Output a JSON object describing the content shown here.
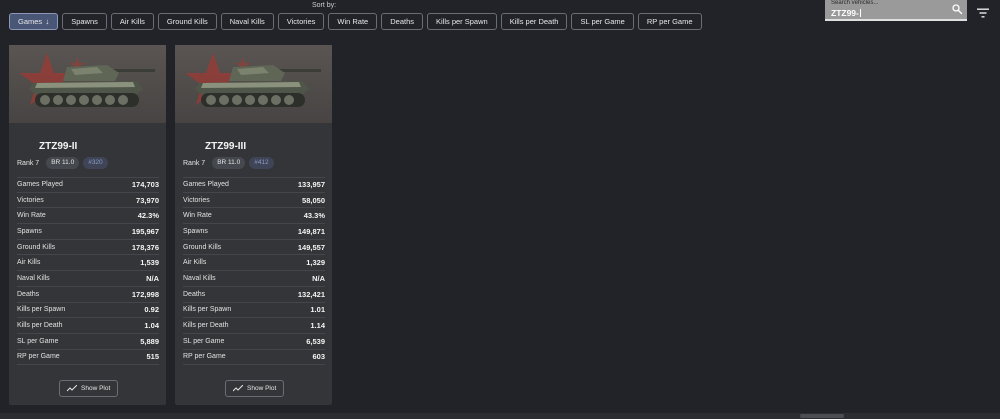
{
  "sort_label": "Sort by:",
  "sort_options": [
    {
      "label": "Games",
      "active": true,
      "icon": "arrow-down-icon"
    },
    {
      "label": "Spawns"
    },
    {
      "label": "Air Kills"
    },
    {
      "label": "Ground Kills"
    },
    {
      "label": "Naval Kills"
    },
    {
      "label": "Victories"
    },
    {
      "label": "Win Rate"
    },
    {
      "label": "Deaths"
    },
    {
      "label": "Kills per Spawn"
    },
    {
      "label": "Kills per Death"
    },
    {
      "label": "SL per Game"
    },
    {
      "label": "RP per Game"
    }
  ],
  "search": {
    "placeholder": "Search vehicles...",
    "value": "ZTZ99-"
  },
  "colors": {
    "background": "#212328",
    "card": "#343538",
    "active_sort": "#4a5676",
    "flag": "#a3312e"
  },
  "vehicles": [
    {
      "name": "ZTZ99-II",
      "rank": "Rank 7",
      "br": "BR 11.0",
      "index": "#320",
      "nation_icon": "china-flag-icon",
      "stats": [
        {
          "label": "Games Played",
          "value": "174,703"
        },
        {
          "label": "Victories",
          "value": "73,970"
        },
        {
          "label": "Win Rate",
          "value": "42.3%"
        },
        {
          "label": "Spawns",
          "value": "195,967"
        },
        {
          "label": "Ground Kills",
          "value": "178,376"
        },
        {
          "label": "Air Kills",
          "value": "1,539"
        },
        {
          "label": "Naval Kills",
          "value": "N/A"
        },
        {
          "label": "Deaths",
          "value": "172,998"
        },
        {
          "label": "Kills per Spawn",
          "value": "0.92"
        },
        {
          "label": "Kills per Death",
          "value": "1.04"
        },
        {
          "label": "SL per Game",
          "value": "5,889"
        },
        {
          "label": "RP per Game",
          "value": "515"
        }
      ],
      "plot_label": "Show Plot"
    },
    {
      "name": "ZTZ99-III",
      "rank": "Rank 7",
      "br": "BR 11.0",
      "index": "#412",
      "nation_icon": "china-flag-icon",
      "stats": [
        {
          "label": "Games Played",
          "value": "133,957"
        },
        {
          "label": "Victories",
          "value": "58,050"
        },
        {
          "label": "Win Rate",
          "value": "43.3%"
        },
        {
          "label": "Spawns",
          "value": "149,871"
        },
        {
          "label": "Ground Kills",
          "value": "149,557"
        },
        {
          "label": "Air Kills",
          "value": "1,329"
        },
        {
          "label": "Naval Kills",
          "value": "N/A"
        },
        {
          "label": "Deaths",
          "value": "132,421"
        },
        {
          "label": "Kills per Spawn",
          "value": "1.01"
        },
        {
          "label": "Kills per Death",
          "value": "1.14"
        },
        {
          "label": "SL per Game",
          "value": "6,539"
        },
        {
          "label": "RP per Game",
          "value": "603"
        }
      ],
      "plot_label": "Show Plot"
    }
  ]
}
